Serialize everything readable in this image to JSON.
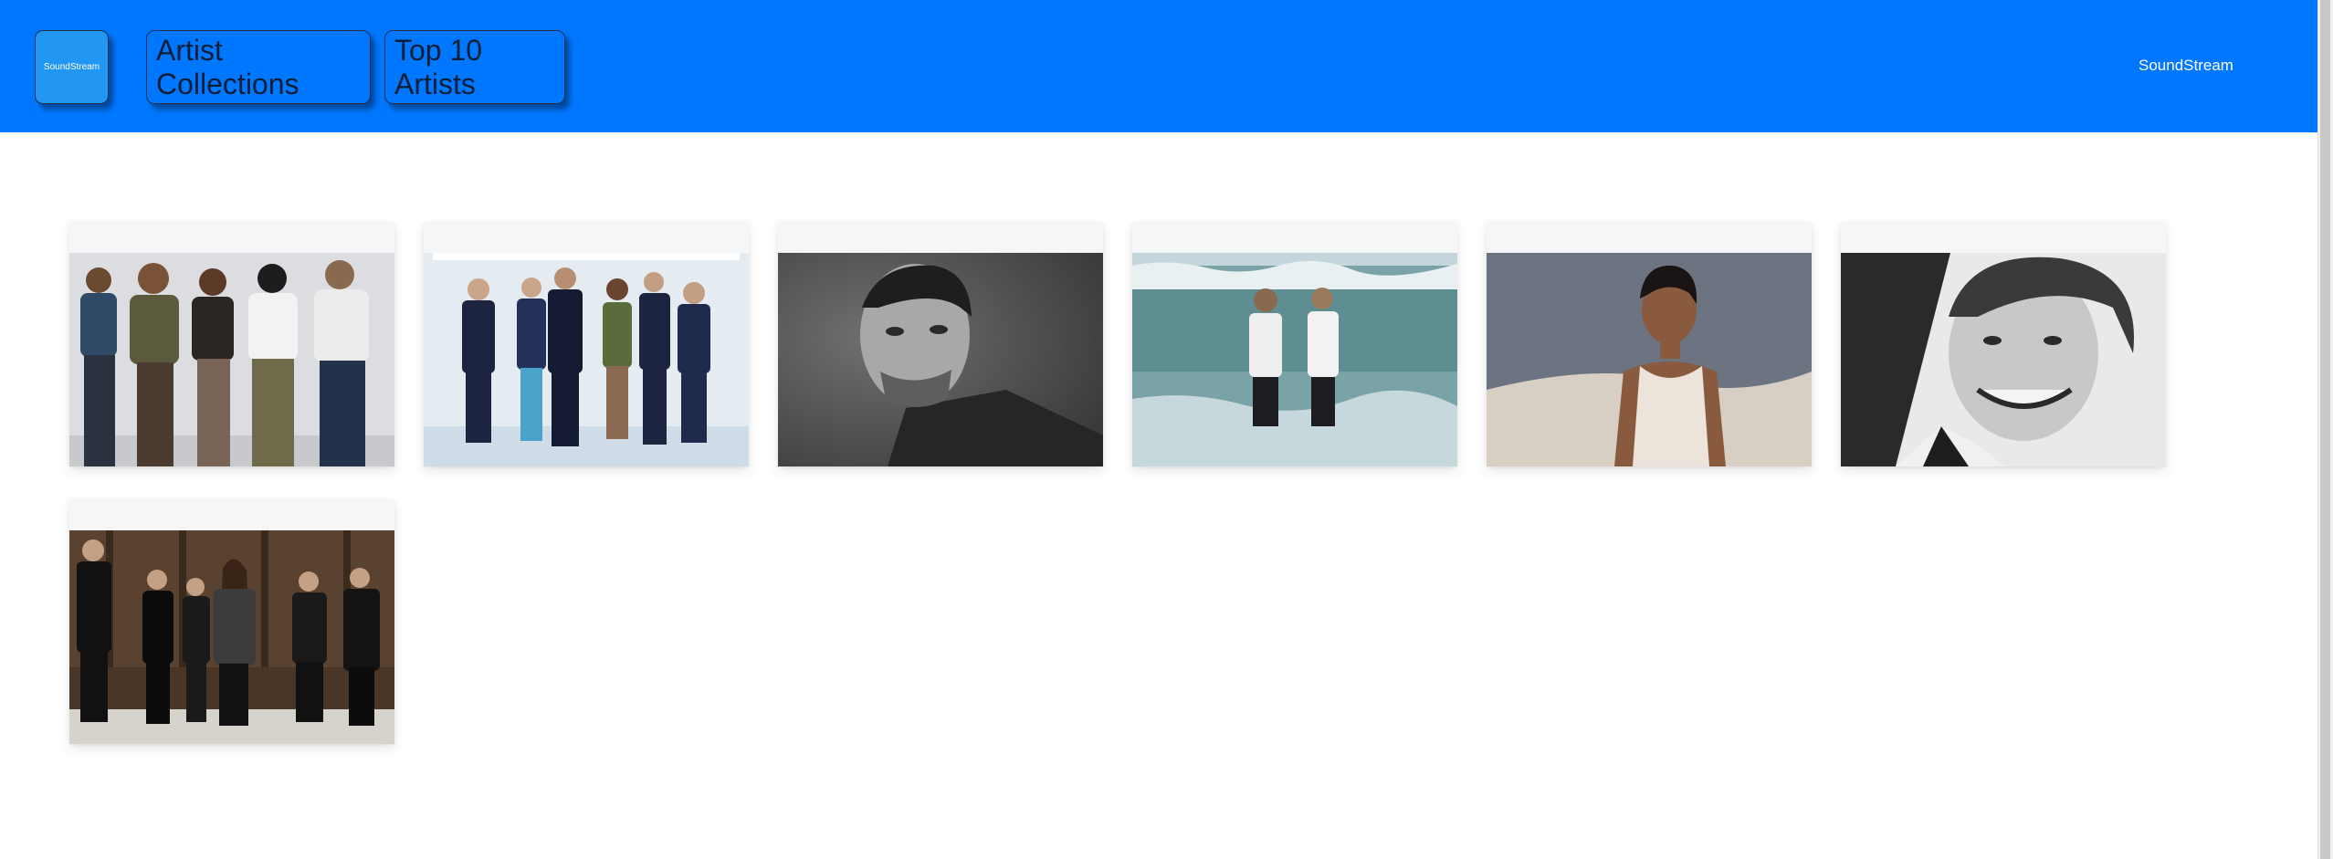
{
  "header": {
    "logo_label": "SoundStream",
    "nav": [
      {
        "label": "Artist Collections"
      },
      {
        "label": "Top 10 Artists"
      }
    ],
    "brand_text": "SoundStream"
  },
  "colors": {
    "header_bg": "#0077ff",
    "logo_bg": "#2196f3",
    "button_border": "#1c2f4a",
    "card_bg": "#f5f6f7"
  },
  "artists": [
    {
      "photo": "band-of-five-on-light-backdrop"
    },
    {
      "photo": "band-in-navy-suits-on-white-stage"
    },
    {
      "photo": "man-portrait-black-and-white"
    },
    {
      "photo": "duo-standing-in-ocean-waves"
    },
    {
      "photo": "singer-in-white-tank-top"
    },
    {
      "photo": "smiling-man-vintage-portrait"
    },
    {
      "photo": "band-of-six-in-wood-room"
    }
  ]
}
